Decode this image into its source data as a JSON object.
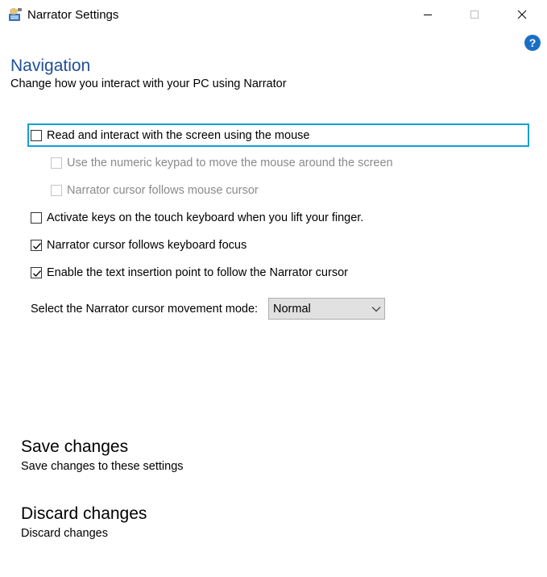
{
  "window": {
    "title": "Narrator Settings",
    "controls": {
      "minimize": "minimize",
      "maximize": "maximize",
      "close": "close"
    },
    "help_label": "?"
  },
  "page": {
    "heading": "Navigation",
    "subheading": "Change how you interact with your PC using Narrator"
  },
  "options": [
    {
      "label": "Read and interact with the screen using the mouse",
      "checked": false,
      "enabled": true,
      "focused": true,
      "access_key": "R"
    },
    {
      "label": "Use the numeric keypad to move the mouse around the screen",
      "checked": false,
      "enabled": false,
      "access_key": "U"
    },
    {
      "label": "Narrator cursor follows mouse cursor",
      "checked": false,
      "enabled": false,
      "access_key": "m"
    },
    {
      "label": "Activate keys on the touch keyboard when you lift your finger.",
      "checked": false,
      "enabled": true,
      "access_key": "f"
    },
    {
      "label": "Narrator cursor follows keyboard focus",
      "checked": true,
      "enabled": true,
      "access_key": "k"
    },
    {
      "label": "Enable the text insertion point to follow the Narrator cursor",
      "checked": true,
      "enabled": true,
      "access_key": "i"
    }
  ],
  "cursor_mode": {
    "label": "Select the Narrator cursor movement mode:",
    "selected": "Normal"
  },
  "actions": {
    "save_title": "Save changes",
    "save_desc": "Save changes to these settings",
    "discard_title": "Discard changes",
    "discard_desc": "Discard changes"
  },
  "colors": {
    "heading": "#1f4e99",
    "focus_ring": "#139fd9",
    "help_badge": "#1a6fc4",
    "disabled_text": "#8a8a8a"
  }
}
